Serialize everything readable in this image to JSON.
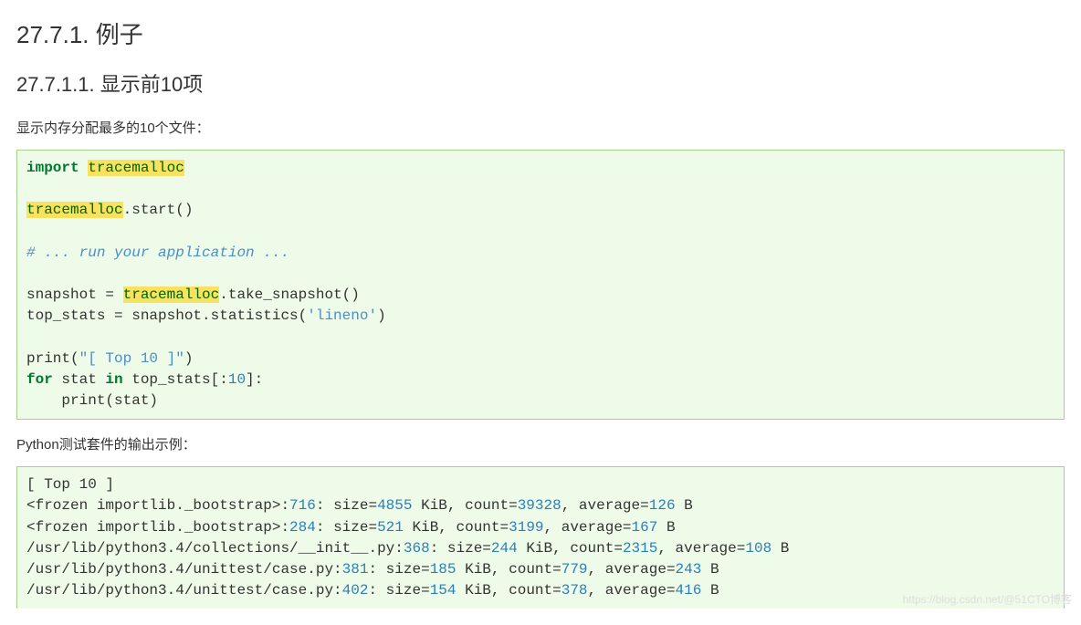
{
  "headings": {
    "h2": "27.7.1. 例子",
    "h3": "27.7.1.1. 显示前10项"
  },
  "paras": {
    "p1": "显示内存分配最多的10个文件：",
    "p2": "Python测试套件的输出示例："
  },
  "code1": {
    "kw_import": "import",
    "mod": "tracemalloc",
    "line_start": ".start()",
    "comment": "# ... run your application ...",
    "snap_lhs": "snapshot = ",
    "snap_rhs": ".take_snapshot()",
    "top_lhs": "top_stats = snapshot.statistics(",
    "str_lineno": "'lineno'",
    "top_rhs": ")",
    "print1_l": "print(",
    "print1_s": "\"[ Top 10 ]\"",
    "print1_r": ")",
    "kw_for": "for",
    "for_mid": " stat ",
    "kw_in": "in",
    "for_rest": " top_stats[:",
    "num_10": "10",
    "for_end": "]:",
    "print2": "    print(stat)"
  },
  "output": {
    "line1_txt": "[ Top 10 ]",
    "line2_a": "<frozen importlib._bootstrap>:",
    "line2_n1": "716",
    "line2_b": ": size=",
    "line2_n2": "4855",
    "line2_c": " KiB, count=",
    "line2_n3": "39328",
    "line2_d": ", average=",
    "line2_n4": "126",
    "line2_e": " B",
    "line3_a": "<frozen importlib._bootstrap>:",
    "line3_n1": "284",
    "line3_b": ": size=",
    "line3_n2": "521",
    "line3_c": " KiB, count=",
    "line3_n3": "3199",
    "line3_d": ", average=",
    "line3_n4": "167",
    "line3_e": " B",
    "line4_a": "/usr/lib/python3.4/collections/__init__.py:",
    "line4_n1": "368",
    "line4_b": ": size=",
    "line4_n2": "244",
    "line4_c": " KiB, count=",
    "line4_n3": "2315",
    "line4_d": ", average=",
    "line4_n4": "108",
    "line4_e": " B",
    "line5_a": "/usr/lib/python3.4/unittest/case.py:",
    "line5_n1": "381",
    "line5_b": ": size=",
    "line5_n2": "185",
    "line5_c": " KiB, count=",
    "line5_n3": "779",
    "line5_d": ", average=",
    "line5_n4": "243",
    "line5_e": " B",
    "line6_a": "/usr/lib/python3.4/unittest/case.py:",
    "line6_n1": "402",
    "line6_b": ": size=",
    "line6_n2": "154",
    "line6_c": " KiB, count=",
    "line6_n3": "378",
    "line6_d": ", average=",
    "line6_n4": "416",
    "line6_e": " B"
  },
  "watermark": "https://blog.csdn.net/@51CTO博客"
}
